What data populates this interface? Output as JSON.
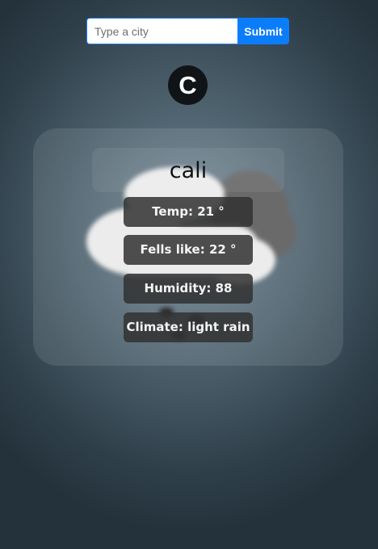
{
  "search": {
    "placeholder": "Type a city",
    "value": "",
    "submit_label": "Submit"
  },
  "logo": {
    "letter": "C"
  },
  "weather": {
    "city": "cali",
    "temp": "Temp: 21 °",
    "feels_like": "Fells like: 22 °",
    "humidity": "Humidity: 88",
    "climate": "Climate: light rain",
    "icon": "rain-cloud-icon"
  },
  "colors": {
    "accent": "#0b7dfb",
    "logo_bg": "#111417",
    "pill_bg": "#323232"
  }
}
